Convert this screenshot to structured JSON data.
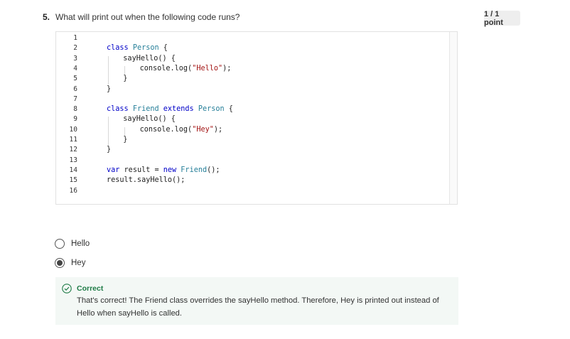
{
  "question": {
    "number": "5.",
    "text": "What will print out when the following code runs?",
    "points": "1 / 1 point"
  },
  "code": {
    "line_numbers": [
      "1",
      "2",
      "3",
      "4",
      "5",
      "6",
      "7",
      "8",
      "9",
      "10",
      "11",
      "12",
      "13",
      "14",
      "15",
      "16"
    ],
    "lines": [
      {
        "n": 2,
        "indent": 0,
        "tokens": [
          [
            "kw",
            "class "
          ],
          [
            "cls",
            "Person"
          ],
          [
            "p",
            " {"
          ]
        ]
      },
      {
        "n": 3,
        "indent": 1,
        "tokens": [
          [
            "p",
            "sayHello() {"
          ]
        ]
      },
      {
        "n": 4,
        "indent": 2,
        "tokens": [
          [
            "p",
            "console.log("
          ],
          [
            "str",
            "\"Hello\""
          ],
          [
            "p",
            ");"
          ]
        ]
      },
      {
        "n": 5,
        "indent": 1,
        "tokens": [
          [
            "p",
            "}"
          ]
        ]
      },
      {
        "n": 6,
        "indent": 0,
        "tokens": [
          [
            "p",
            "}"
          ]
        ]
      },
      {
        "n": 8,
        "indent": 0,
        "tokens": [
          [
            "kw",
            "class "
          ],
          [
            "cls",
            "Friend"
          ],
          [
            "kw",
            " extends "
          ],
          [
            "cls",
            "Person"
          ],
          [
            "p",
            " {"
          ]
        ]
      },
      {
        "n": 9,
        "indent": 1,
        "tokens": [
          [
            "p",
            "sayHello() {"
          ]
        ]
      },
      {
        "n": 10,
        "indent": 2,
        "tokens": [
          [
            "p",
            "console.log("
          ],
          [
            "str",
            "\"Hey\""
          ],
          [
            "p",
            ");"
          ]
        ]
      },
      {
        "n": 11,
        "indent": 1,
        "tokens": [
          [
            "p",
            "}"
          ]
        ]
      },
      {
        "n": 12,
        "indent": 0,
        "tokens": [
          [
            "p",
            "}"
          ]
        ]
      },
      {
        "n": 14,
        "indent": 0,
        "tokens": [
          [
            "kw",
            "var "
          ],
          [
            "p",
            "result = "
          ],
          [
            "kw",
            "new "
          ],
          [
            "cls",
            "Friend"
          ],
          [
            "p",
            "();"
          ]
        ]
      },
      {
        "n": 15,
        "indent": 0,
        "tokens": [
          [
            "p",
            "result.sayHello();"
          ]
        ]
      }
    ]
  },
  "options": [
    {
      "label": "Hello",
      "selected": false
    },
    {
      "label": "Hey",
      "selected": true
    }
  ],
  "feedback": {
    "title": "Correct",
    "text_parts": [
      {
        "t": "text",
        "v": "That's correct! The Friend class overrides the "
      },
      {
        "t": "code",
        "v": "sayHello"
      },
      {
        "t": "text",
        "v": " method. Therefore, "
      },
      {
        "t": "code",
        "v": "Hey"
      },
      {
        "t": "text",
        "v": " is printed out instead of "
      },
      {
        "t": "code",
        "v": "Hello"
      },
      {
        "t": "text",
        "v": " when "
      },
      {
        "t": "code",
        "v": "sayHello"
      },
      {
        "t": "text",
        "v": " is called."
      }
    ],
    "color": "#1e7b46"
  }
}
